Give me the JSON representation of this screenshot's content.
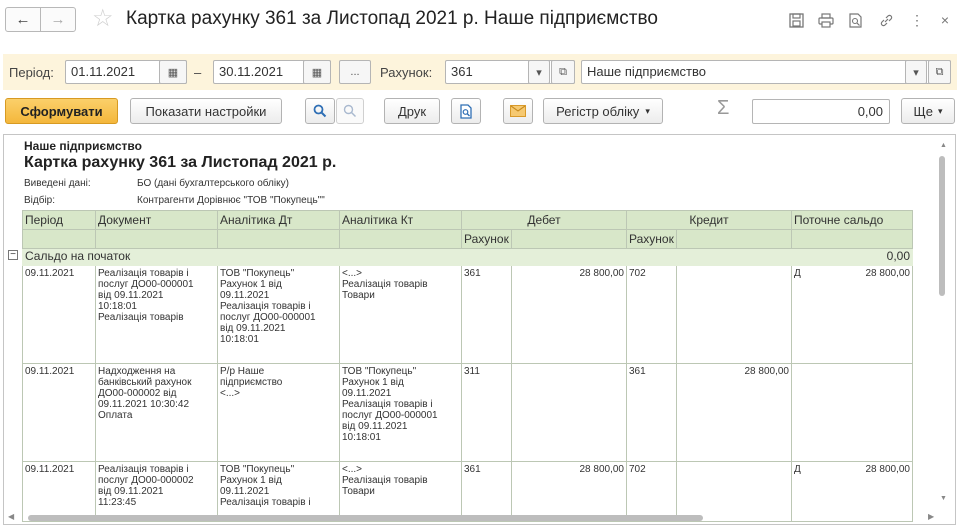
{
  "window": {
    "title": "Картка рахунку 361 за Листопад 2021 р. Наше підприємство"
  },
  "icons": {
    "back": "arrow-left-icon",
    "forward": "arrow-right-icon",
    "favorite": "star-icon",
    "save": "floppy-icon",
    "print": "printer-icon",
    "preview": "print-preview-icon",
    "link": "link-icon",
    "more": "more-vertical-icon",
    "close": "close-icon"
  },
  "filters": {
    "period_label": "Період:",
    "date_from": "01.11.2021",
    "dash": "–",
    "date_to": "30.11.2021",
    "ellipsis_btn": "...",
    "account_label": "Рахунок:",
    "account": "361",
    "organization": "Наше підприємство"
  },
  "toolbar": {
    "generate": "Сформувати",
    "show_settings": "Показати настройки",
    "print": "Друк",
    "accounting_register": "Регістр обліку",
    "sum_value": "0,00",
    "more": "Ще"
  },
  "report": {
    "organization": "Наше підприємство",
    "title": "Картка рахунку 361 за Листопад 2021 р.",
    "output_label": "Виведені дані:",
    "output_value": "БО (дані бухгалтерського обліку)",
    "filter_label": "Відбір:",
    "filter_value": "Контрагенти Дорівнює \"ТОВ \"Покупець\"\"",
    "headers": {
      "period": "Період",
      "document": "Документ",
      "analytics_dt": "Аналітика Дт",
      "analytics_kt": "Аналітика Кт",
      "debit": "Дебет",
      "credit": "Кредит",
      "balance": "Поточне сальдо",
      "account": "Рахунок"
    },
    "opening": {
      "label": "Сальдо на початок",
      "value": "0,00"
    },
    "rows": [
      {
        "period": "09.11.2021",
        "document": "Реалізація товарів і\nпослуг ДО00-000001\nвід 09.11.2021\n10:18:01\nРеалізація товарів",
        "analytics_dt": "ТОВ \"Покупець\"\nРахунок 1 від\n09.11.2021\nРеалізація товарів і\nпослуг ДО00-000001\nвід 09.11.2021\n10:18:01",
        "analytics_kt": "<...>\nРеалізація товарів\nТовари",
        "debit_account": "361",
        "debit_amount": "28 800,00",
        "credit_account": "702",
        "credit_amount": "",
        "balance_type": "Д",
        "balance_amount": "28 800,00"
      },
      {
        "period": "09.11.2021",
        "document": "Надходження на\nбанківський рахунок\nДО00-000002 від\n09.11.2021 10:30:42\nОплата",
        "analytics_dt": "Р/р Наше\nпідприємство\n<...>",
        "analytics_kt": "ТОВ \"Покупець\"\nРахунок 1 від\n09.11.2021\nРеалізація товарів і\nпослуг ДО00-000001\nвід 09.11.2021\n10:18:01",
        "debit_account": "311",
        "debit_amount": "",
        "credit_account": "361",
        "credit_amount": "28 800,00",
        "balance_type": "",
        "balance_amount": ""
      },
      {
        "period": "09.11.2021",
        "document": "Реалізація товарів і\nпослуг ДО00-000002\nвід 09.11.2021\n11:23:45",
        "analytics_dt": "ТОВ \"Покупець\"\nРахунок 1 від\n09.11.2021\nРеалізація товарів і",
        "analytics_kt": "<...>\nРеалізація товарів\nТовари",
        "debit_account": "361",
        "debit_amount": "28 800,00",
        "credit_account": "702",
        "credit_amount": "",
        "balance_type": "Д",
        "balance_amount": "28 800,00"
      }
    ]
  }
}
